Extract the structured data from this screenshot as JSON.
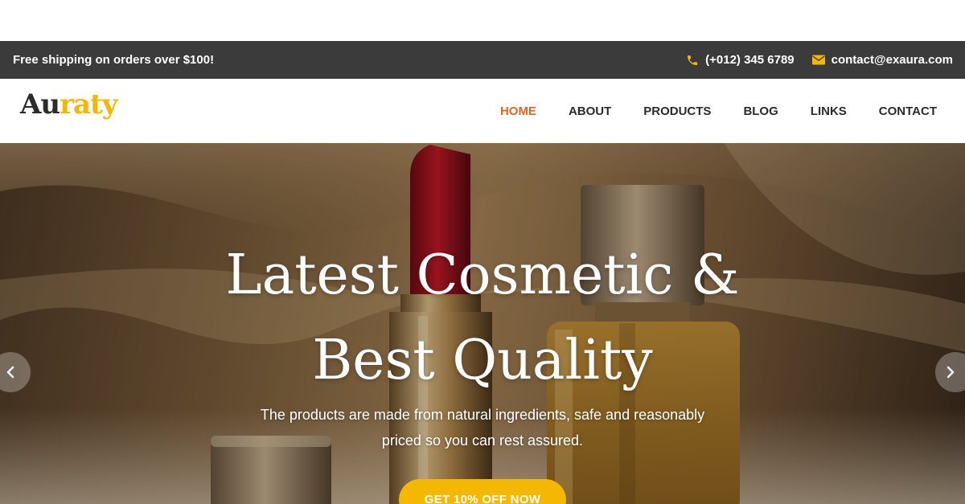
{
  "topbar": {
    "promo": "Free shipping on orders over $100!",
    "phone": "(+012) 345 6789",
    "email": "contact@exaura.com",
    "phone_icon": "phone-icon",
    "email_icon": "envelope-icon"
  },
  "brand": {
    "part1": "Au",
    "part2": "raty"
  },
  "nav": {
    "items": [
      {
        "label": "HOME",
        "active": true
      },
      {
        "label": "ABOUT"
      },
      {
        "label": "PRODUCTS"
      },
      {
        "label": "BLOG"
      },
      {
        "label": "LINKS"
      },
      {
        "label": "CONTACT"
      }
    ]
  },
  "hero": {
    "title_line1": "Latest Cosmetic &",
    "title_line2": "Best Quality",
    "subtitle_line1": "The products are made from natural ingredients, safe and reasonably",
    "subtitle_line2": "priced so you can rest assured.",
    "cta": "GET 10% OFF NOW",
    "prev_icon": "chevron-left-icon",
    "next_icon": "chevron-right-icon"
  },
  "colors": {
    "accent": "#f5b800",
    "active_nav": "#e8641a",
    "topbar_bg": "#3b3b3b"
  }
}
